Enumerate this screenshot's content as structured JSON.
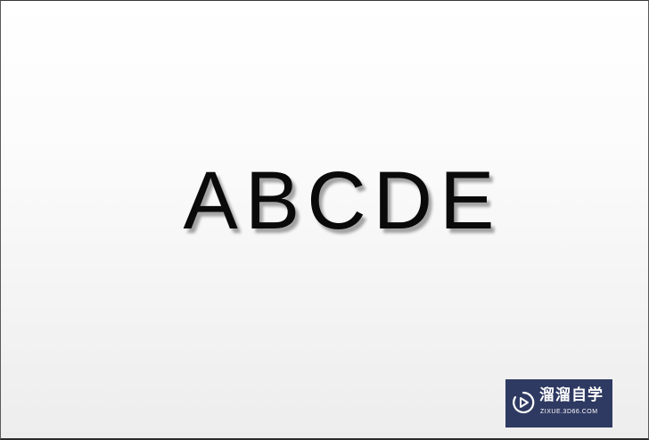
{
  "slide": {
    "title": "ABCDE"
  },
  "watermark": {
    "icon": "play-logo-icon",
    "name": "溜溜自学",
    "url": "ZIXUE.3D66.COM",
    "background_color": "#2f3a62"
  }
}
